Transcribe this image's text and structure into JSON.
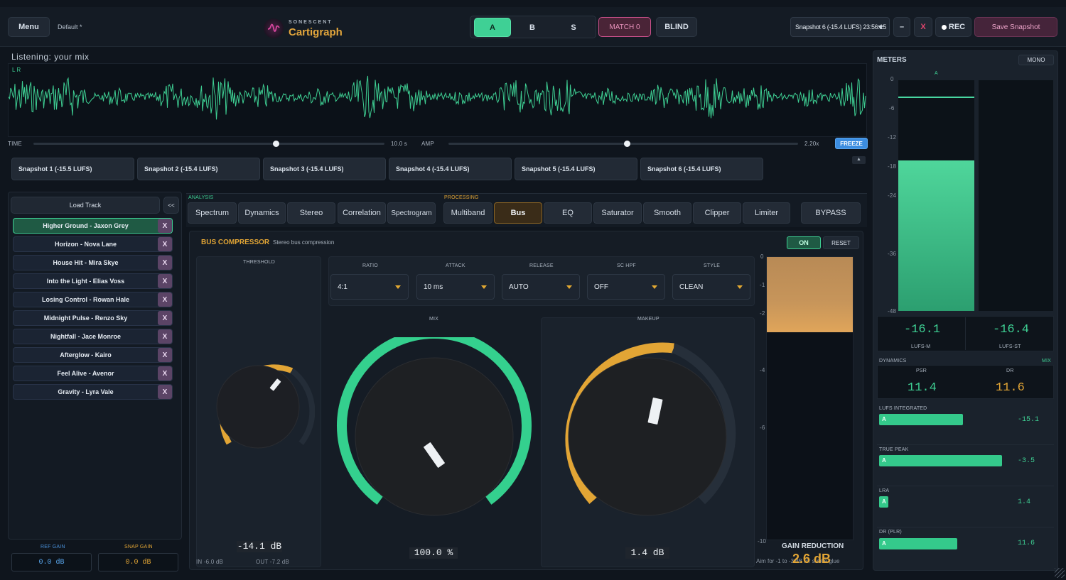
{
  "header": {
    "menu": "Menu",
    "preset": "Default",
    "preset_star": "*",
    "brand_top": "SONESCENT",
    "brand_name": "Cartigraph",
    "ab": [
      "A",
      "B",
      "S"
    ],
    "match": "MATCH 0",
    "blind": "BLIND",
    "snapshot_select": "Snapshot 6 (-15.4 LUFS) 23:56:15",
    "minimize": "–",
    "close": "X",
    "rec": "REC",
    "save": "Save Snapshot"
  },
  "waveform": {
    "listening": "Listening: your mix",
    "channels": "L  R",
    "time_label": "TIME",
    "time_value": "10.0 s",
    "time_pos": 0.69,
    "amp_label": "AMP",
    "amp_value": "2.20x",
    "amp_pos": 0.51,
    "freeze": "FREEZE"
  },
  "snapshots": [
    "Snapshot 1 (-15.5 LUFS)",
    "Snapshot 2 (-15.4 LUFS)",
    "Snapshot 3 (-15.4 LUFS)",
    "Snapshot 4 (-15.4 LUFS)",
    "Snapshot 5 (-15.4 LUFS)",
    "Snapshot 6 (-15.4 LUFS)"
  ],
  "sidebar": {
    "load_track": "Load Track",
    "collapse": "<<",
    "tracks": [
      "Higher Ground - Jaxon Grey",
      "Horizon - Nova Lane",
      "House Hit - Mira Skye",
      "Into the Light - Elias Voss",
      "Losing Control - Rowan Hale",
      "Midnight Pulse - Renzo Sky",
      "Nightfall - Jace Monroe",
      "Afterglow - Kairo",
      "Feel Alive - Avenor",
      "Gravity - Lyra Vale"
    ],
    "remove": "X",
    "ref_gain_label": "REF GAIN",
    "ref_gain_value": "0.0 dB",
    "snap_gain_label": "SNAP GAIN",
    "snap_gain_value": "0.0 dB"
  },
  "tabs": {
    "analysis_label": "ANALYSIS",
    "processing_label": "PROCESSING",
    "analysis": [
      "Spectrum",
      "Dynamics",
      "Stereo",
      "Correlation",
      "Spectrogram"
    ],
    "processing": [
      "Multiband",
      "Bus",
      "EQ",
      "Saturator",
      "Smooth",
      "Clipper",
      "Limiter"
    ],
    "bypass": "BYPASS",
    "active": "Bus"
  },
  "bus": {
    "title": "BUS COMPRESSOR",
    "subtitle": "Stereo bus compression",
    "on": "ON",
    "reset": "RESET",
    "threshold_label": "THRESHOLD",
    "threshold_value": "-14.1 dB",
    "in_level": "IN -6.0 dB",
    "out_level": "OUT -7.2 dB",
    "selects": [
      {
        "label": "RATIO",
        "value": "4:1"
      },
      {
        "label": "ATTACK",
        "value": "10 ms"
      },
      {
        "label": "RELEASE",
        "value": "AUTO"
      },
      {
        "label": "SC HPF",
        "value": "OFF"
      },
      {
        "label": "STYLE",
        "value": "CLEAN"
      }
    ],
    "mix_label": "MIX",
    "mix_value": "100.0 %",
    "makeup_label": "MAKEUP",
    "makeup_value": "1.4 dB",
    "gr_scale": [
      "0",
      "-1",
      "-2",
      "-4",
      "-6",
      "-10"
    ],
    "gr_label": "GAIN REDUCTION",
    "gr_value": "2.6 dB",
    "gr_hint": "Aim for -1 to -3 dB for subtle glue"
  },
  "meters": {
    "title": "METERS",
    "mono": "MONO",
    "channel": "A",
    "scale": [
      "0",
      "-6",
      "-12",
      "-18",
      "-24",
      "-36",
      "-48"
    ],
    "lufs_m": "-16.1",
    "lufs_m_label": "LUFS-M",
    "lufs_st": "-16.4",
    "lufs_st_label": "LUFS-ST",
    "dynamics_label": "DYNAMICS",
    "mix_label": "MIX",
    "psr_label": "PSR",
    "psr_value": "11.4",
    "dr_label": "DR",
    "dr_value": "11.6",
    "rows": [
      {
        "label": "LUFS INTEGRATED",
        "tag": "A",
        "value": "-15.1",
        "fill": 0.62
      },
      {
        "label": "TRUE PEAK",
        "tag": "A",
        "value": "-3.5",
        "fill": 0.91
      },
      {
        "label": "LRA",
        "tag": "A",
        "value": "1.4",
        "fill": 0.07
      },
      {
        "label": "DR (PLR)",
        "tag": "A",
        "value": "11.6",
        "fill": 0.58
      }
    ]
  },
  "colors": {
    "accent": "#3ecf93",
    "orange": "#e2a535",
    "pink": "#c9508a",
    "bg": "#0f151d"
  }
}
